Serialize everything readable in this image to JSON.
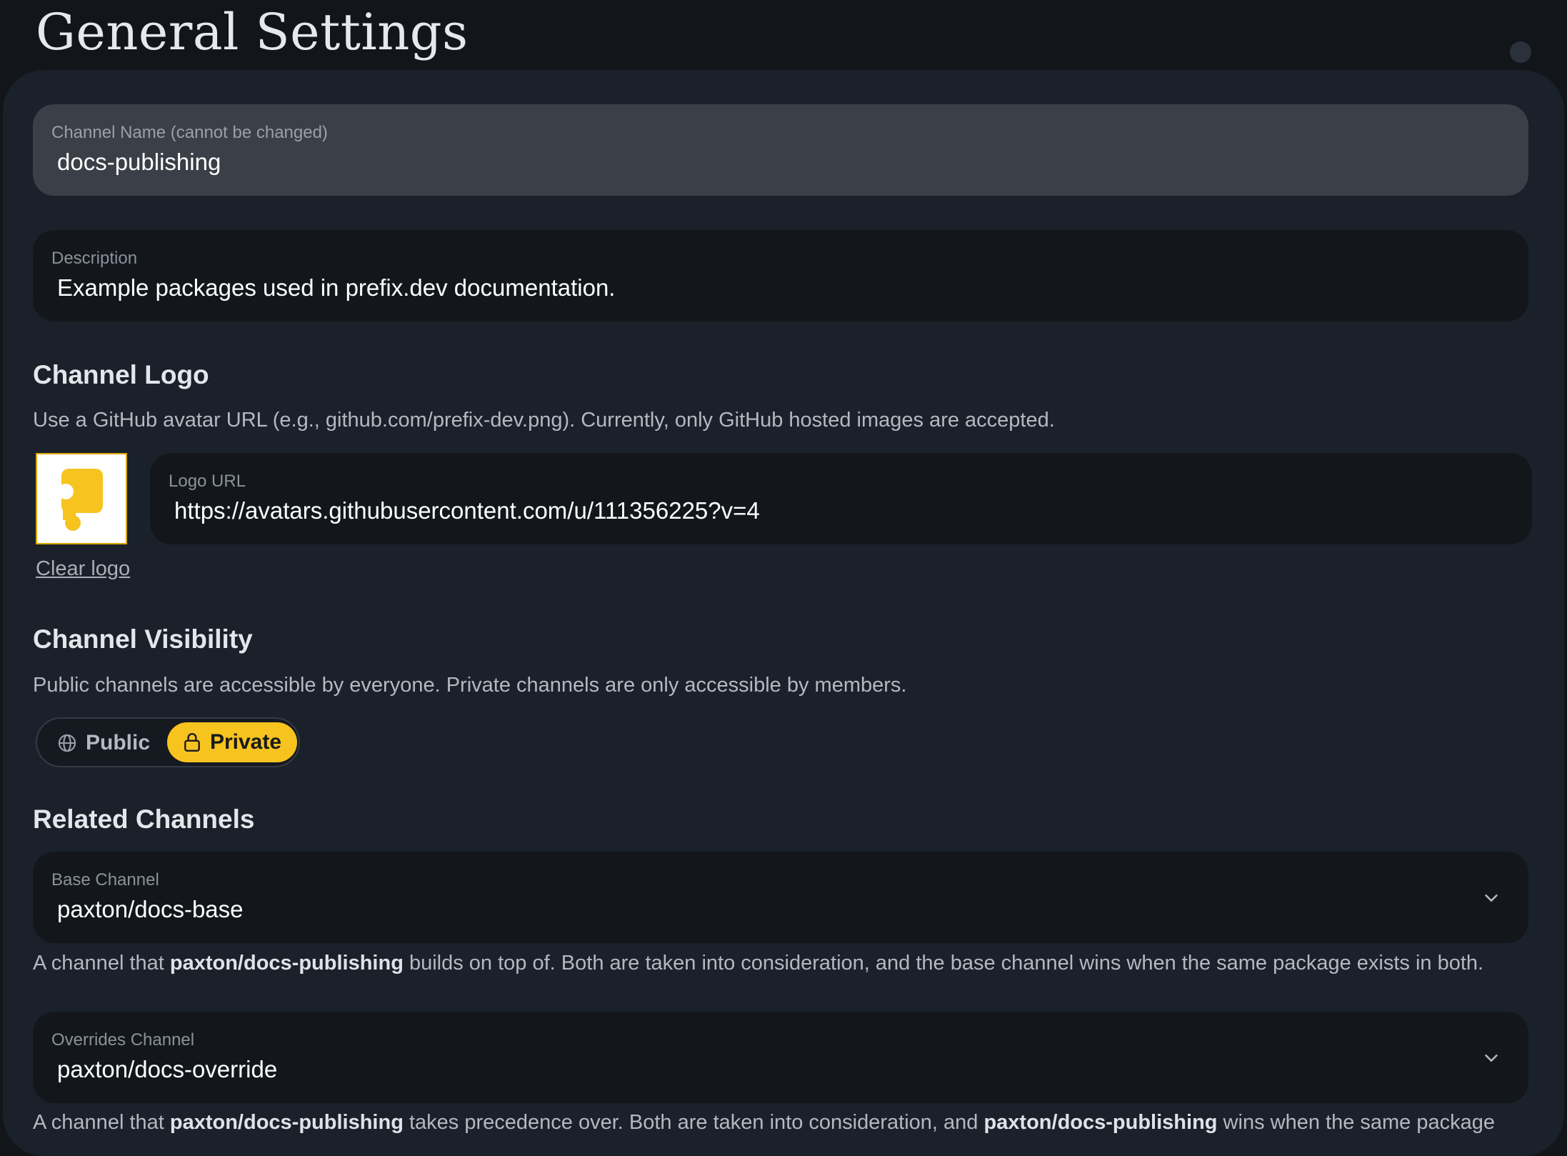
{
  "page": {
    "title": "General Settings"
  },
  "channel_name": {
    "label": "Channel Name (cannot be changed)",
    "value": "docs-publishing"
  },
  "description": {
    "label": "Description",
    "value": "Example packages used in prefix.dev documentation."
  },
  "channel_logo": {
    "heading": "Channel Logo",
    "help": "Use a GitHub avatar URL (e.g., github.com/prefix-dev.png). Currently, only GitHub hosted images are accepted.",
    "url_label": "Logo URL",
    "url_value": "https://avatars.githubusercontent.com/u/111356225?v=4",
    "clear_label": "Clear logo",
    "logo_color": "#f7c31f"
  },
  "visibility": {
    "heading": "Channel Visibility",
    "help": "Public channels are accessible by everyone. Private channels are only accessible by members.",
    "public_label": "Public",
    "private_label": "Private",
    "selected": "Private",
    "accent": "#f7c31f"
  },
  "related": {
    "heading": "Related Channels",
    "base": {
      "label": "Base Channel",
      "value": "paxton/docs-base",
      "help_prefix": "A channel that ",
      "help_channel": "paxton/docs-publishing",
      "help_suffix": " builds on top of. Both are taken into consideration, and the base channel wins when the same package exists in both."
    },
    "overrides": {
      "label": "Overrides Channel",
      "value": "paxton/docs-override",
      "help_prefix": "A channel that ",
      "help_channel": "paxton/docs-publishing",
      "help_middle": " takes precedence over. Both are taken into consideration, and ",
      "help_channel_2": "paxton/docs-publishing",
      "help_suffix": " wins when the same package"
    }
  }
}
